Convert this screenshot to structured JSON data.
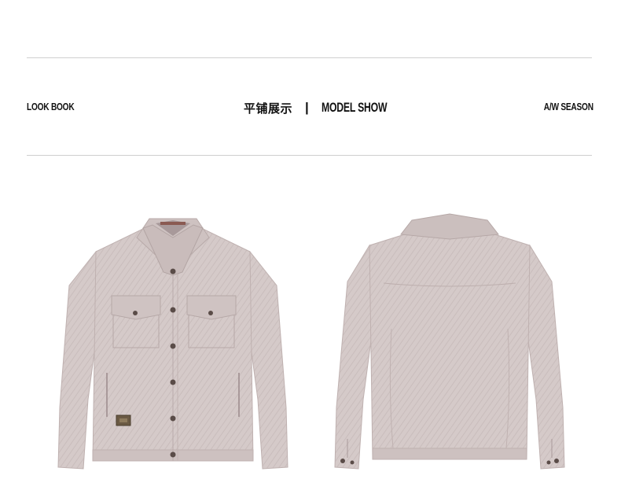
{
  "header": {
    "left_label": "LOOK BOOK",
    "center_cn": "平铺展示",
    "separator": "|",
    "center_en": "MODEL SHOW",
    "right_label": "A/W SEASON"
  },
  "colors": {
    "fabric": "#d5cac9",
    "fabric_shade": "#c4b7b6",
    "fabric_dark": "#b3a5a4",
    "button": "#5a4c48",
    "patch": "#6b5a44",
    "rule": "#cfcfcf"
  },
  "products": [
    {
      "view": "front"
    },
    {
      "view": "back"
    }
  ]
}
